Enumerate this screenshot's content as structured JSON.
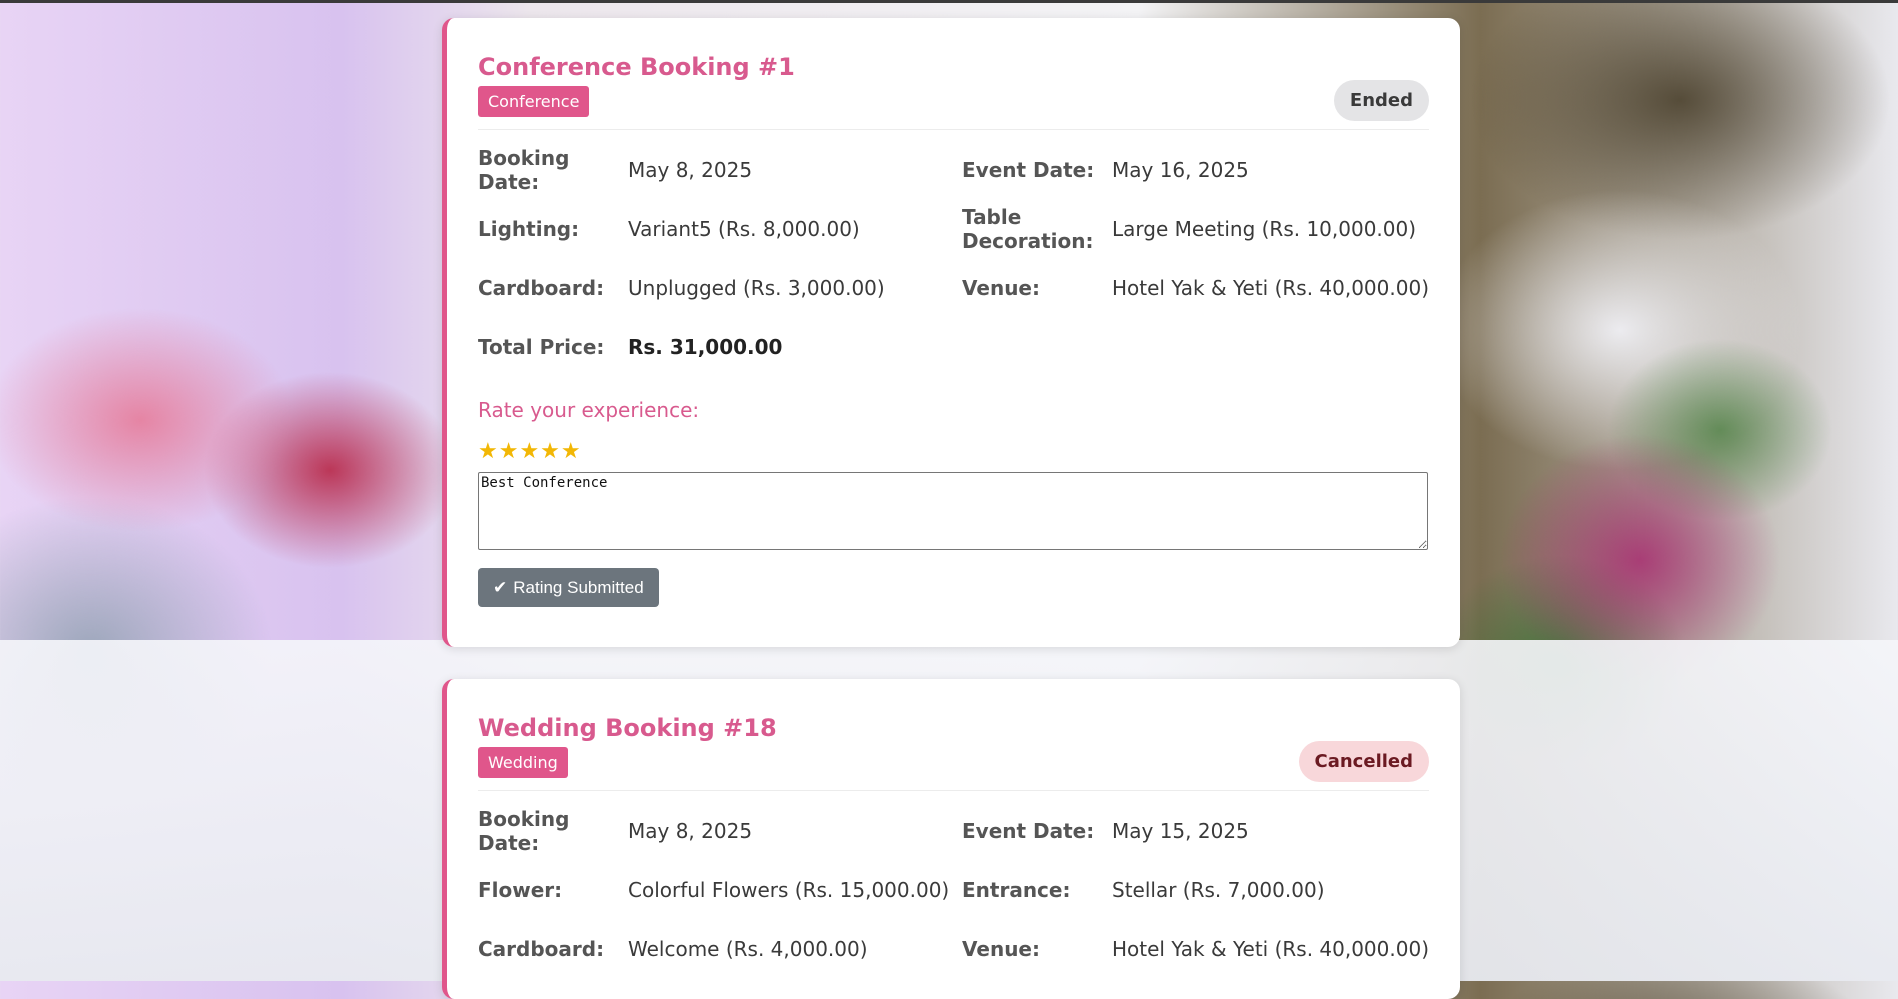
{
  "bookings": [
    {
      "title": "Conference Booking #1",
      "type": "Conference",
      "status": "Ended",
      "details": {
        "booking_date_label": "Booking Date:",
        "booking_date": "May 8, 2025",
        "event_date_label": "Event Date:",
        "event_date": "May 16, 2025",
        "lighting_label": "Lighting:",
        "lighting": "Variant5 (Rs. 8,000.00)",
        "table_decoration_label": "Table Decoration:",
        "table_decoration": "Large Meeting (Rs. 10,000.00)",
        "cardboard_label": "Cardboard:",
        "cardboard": "Unplugged (Rs. 3,000.00)",
        "venue_label": "Venue:",
        "venue": "Hotel Yak & Yeti (Rs. 40,000.00)",
        "total_label": "Total Price:",
        "total": "Rs. 31,000.00"
      },
      "rating": {
        "prompt": "Rate your experience:",
        "stars": "★★★★★",
        "star_count": 5,
        "review_text": "Best Conference",
        "button_label": "Rating Submitted"
      }
    },
    {
      "title": "Wedding Booking #18",
      "type": "Wedding",
      "status": "Cancelled",
      "details": {
        "booking_date_label": "Booking Date:",
        "booking_date": "May 8, 2025",
        "event_date_label": "Event Date:",
        "event_date": "May 15, 2025",
        "flower_label": "Flower:",
        "flower": "Colorful Flowers (Rs. 15,000.00)",
        "entrance_label": "Entrance:",
        "entrance": "Stellar (Rs. 7,000.00)",
        "cardboard_label": "Cardboard:",
        "cardboard": "Welcome (Rs. 4,000.00)",
        "venue_label": "Venue:",
        "venue": "Hotel Yak & Yeti (Rs. 40,000.00)"
      }
    }
  ],
  "colors": {
    "accent": "#e0568b",
    "title": "#d85a8e",
    "star": "#f2b705",
    "button": "#6c757d"
  }
}
